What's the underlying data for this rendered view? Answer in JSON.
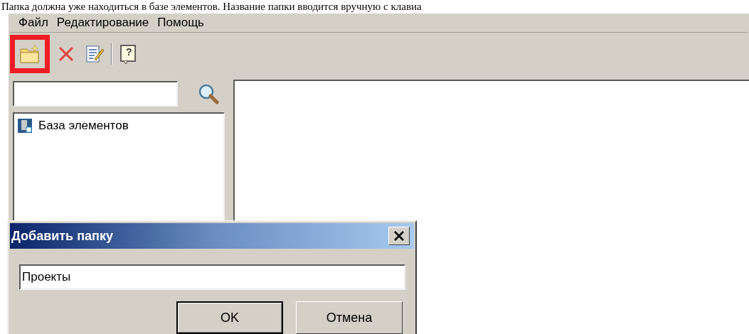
{
  "caption": "Папка должна уже находиться в базе элементов. Название папки вводится вручную с клавиа",
  "menu": [
    "Файл",
    "Редактирование",
    "Помощь"
  ],
  "toolbar": [
    {
      "kind": "new-folder",
      "highlighted": true
    },
    {
      "kind": "delete",
      "highlighted": false
    },
    {
      "kind": "edit",
      "highlighted": false
    },
    {
      "kind": "separator"
    },
    {
      "kind": "help",
      "glyph": "?",
      "highlighted": false
    }
  ],
  "tree": [
    {
      "label": "База элементов"
    }
  ],
  "dialog": {
    "title": "Добавить папку",
    "value": "Проекты",
    "buttons": [
      {
        "label": "OK",
        "default": true
      },
      {
        "label": "Отмена",
        "default": false
      }
    ]
  }
}
